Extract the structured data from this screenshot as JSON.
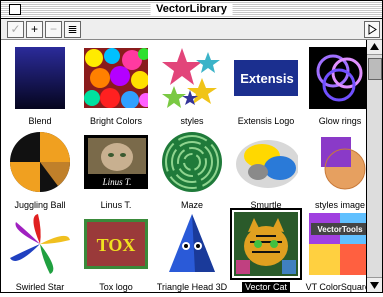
{
  "window": {
    "title": "VectorLibrary"
  },
  "toolbar": {
    "check": "✓",
    "add": "+",
    "remove": "−",
    "list": "≣"
  },
  "items": [
    {
      "label": "Blend"
    },
    {
      "label": "Bright Colors"
    },
    {
      "label": "styles"
    },
    {
      "label": "Extensis Logo",
      "text": "Extensis"
    },
    {
      "label": "Glow rings"
    },
    {
      "label": "Juggling Ball"
    },
    {
      "label": "Linus T.",
      "caption": "Linus T."
    },
    {
      "label": "Maze"
    },
    {
      "label": "Smurtle"
    },
    {
      "label": "styles image"
    },
    {
      "label": "Swirled Star"
    },
    {
      "label": "Tox logo",
      "text": "TOX"
    },
    {
      "label": "Triangle Head 3D"
    },
    {
      "label": "Vector Cat",
      "selected": true
    },
    {
      "label": "VT ColorSquares",
      "text": "VectorTools"
    }
  ]
}
